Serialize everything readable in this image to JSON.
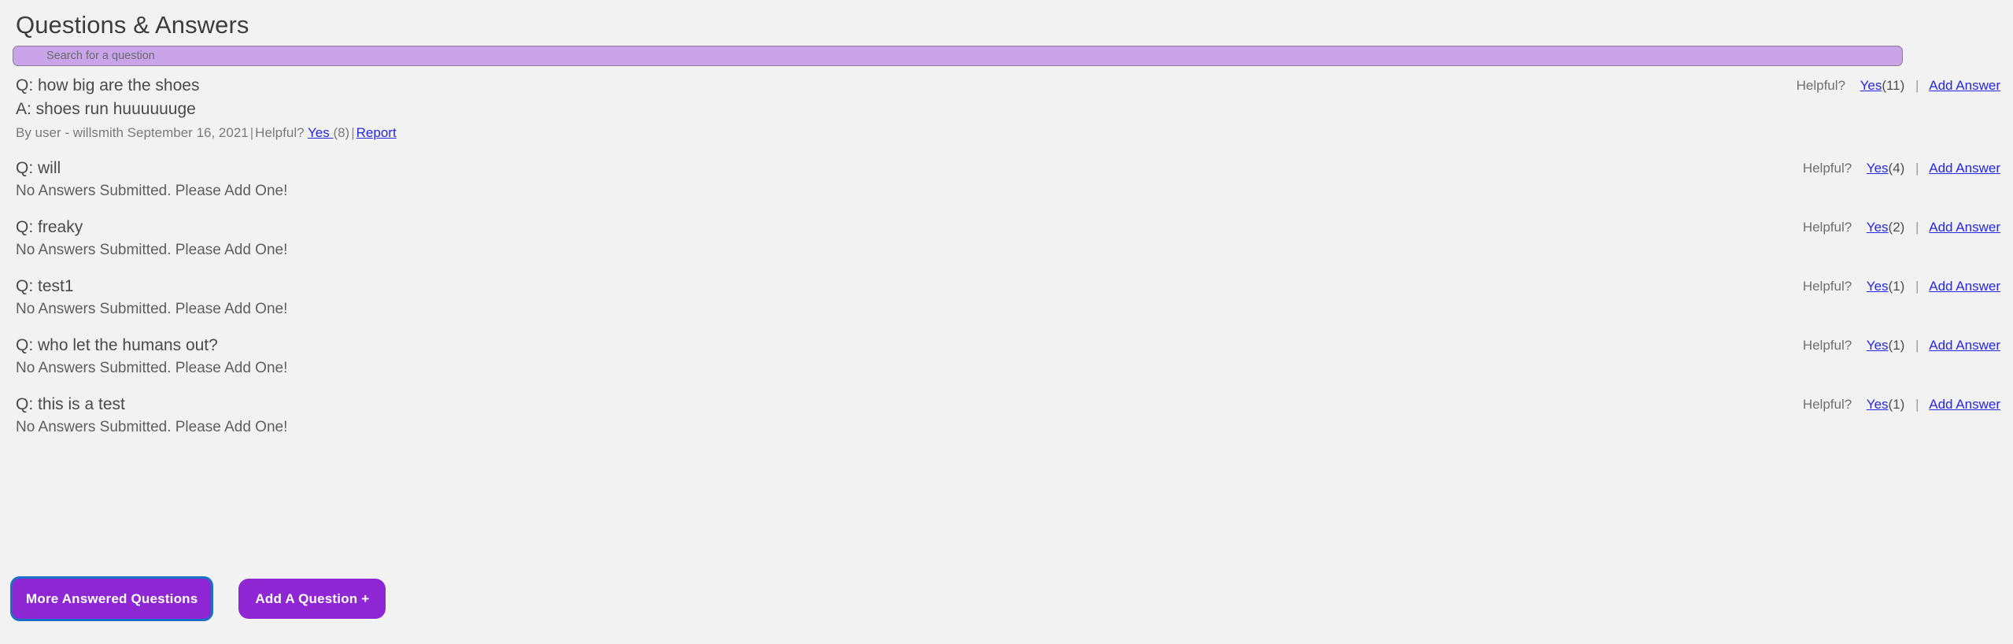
{
  "panel": {
    "title": "Questions & Answers"
  },
  "search": {
    "placeholder": "Search for a question",
    "value": "",
    "fill_color": "#c9a4e8",
    "border_color": "#8b7b93"
  },
  "labels": {
    "helpful": "Helpful?",
    "yes": "Yes",
    "add_answer": "Add Answer",
    "report": "Report",
    "pipe": "|",
    "no_answers": "No Answers Submitted. Please Add One!",
    "byline_helpful": "Helpful?",
    "byline_yes": "Yes "
  },
  "questions": [
    {
      "question": "Q: how big are the shoes",
      "helpful_label": "Helpful?",
      "yes_label": "Yes",
      "helpful_count": "(11)",
      "add_answer": "Add Answer",
      "answers": [
        {
          "text": "A: shoes run huuuuuuge",
          "byline_prefix": "By user - willsmith September 16, 2021",
          "byline_helpful": "Helpful?",
          "byline_yes": "Yes ",
          "byline_count": "(8)",
          "report": "Report"
        }
      ]
    },
    {
      "question": "Q: will",
      "helpful_label": "Helpful?",
      "yes_label": "Yes",
      "helpful_count": "(4)",
      "add_answer": "Add Answer",
      "no_answers": "No Answers Submitted. Please Add One!",
      "answers": []
    },
    {
      "question": "Q: freaky",
      "helpful_label": "Helpful?",
      "yes_label": "Yes",
      "helpful_count": "(2)",
      "add_answer": "Add Answer",
      "no_answers": "No Answers Submitted. Please Add One!",
      "answers": []
    },
    {
      "question": "Q: test1",
      "helpful_label": "Helpful?",
      "yes_label": "Yes",
      "helpful_count": "(1)",
      "add_answer": "Add Answer",
      "no_answers": "No Answers Submitted. Please Add One!",
      "answers": []
    },
    {
      "question": "Q: who let the humans out?",
      "helpful_label": "Helpful?",
      "yes_label": "Yes",
      "helpful_count": "(1)",
      "add_answer": "Add Answer",
      "no_answers": "No Answers Submitted. Please Add One!",
      "answers": []
    },
    {
      "question": "Q: this is a test",
      "helpful_label": "Helpful?",
      "yes_label": "Yes",
      "helpful_count": "(1)",
      "add_answer": "Add Answer",
      "no_answers": "No Answers Submitted. Please Add One!",
      "answers": []
    }
  ],
  "buttons": {
    "more_answered_questions": "More Answered Questions",
    "add_a_question": "Add A Question +",
    "purple": "#8f26d4",
    "focus_ring": "#1a70c4"
  }
}
